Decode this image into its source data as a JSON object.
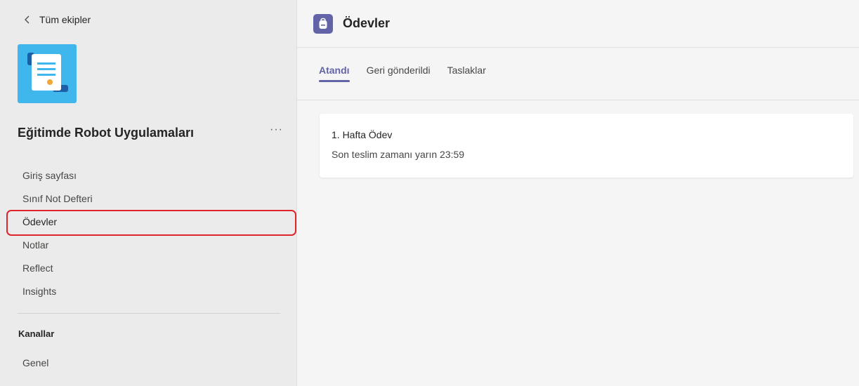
{
  "sidebar": {
    "back_label": "Tüm ekipler",
    "team_name": "Eğitimde Robot Uygulamaları",
    "more_label": "···",
    "team_icon": "scroll-document-icon",
    "nav_items": [
      {
        "label": "Giriş sayfası"
      },
      {
        "label": "Sınıf Not Defteri"
      },
      {
        "label": "Ödevler",
        "active": true
      },
      {
        "label": "Notlar"
      },
      {
        "label": "Reflect"
      },
      {
        "label": "Insights"
      }
    ],
    "section_label": "Kanallar",
    "channels": [
      {
        "label": "Genel"
      }
    ]
  },
  "header": {
    "title": "Ödevler",
    "icon": "backpack-icon",
    "accent": "#6264a7"
  },
  "tabs": [
    {
      "label": "Atandı",
      "active": true
    },
    {
      "label": "Geri gönderildi"
    },
    {
      "label": "Taslaklar"
    }
  ],
  "assignments": [
    {
      "title": "1. Hafta Ödev",
      "due": "Son teslim zamanı yarın 23:59"
    }
  ],
  "colors": {
    "highlight_border": "#e0242b",
    "team_icon_bg": "#3fb7ed"
  }
}
